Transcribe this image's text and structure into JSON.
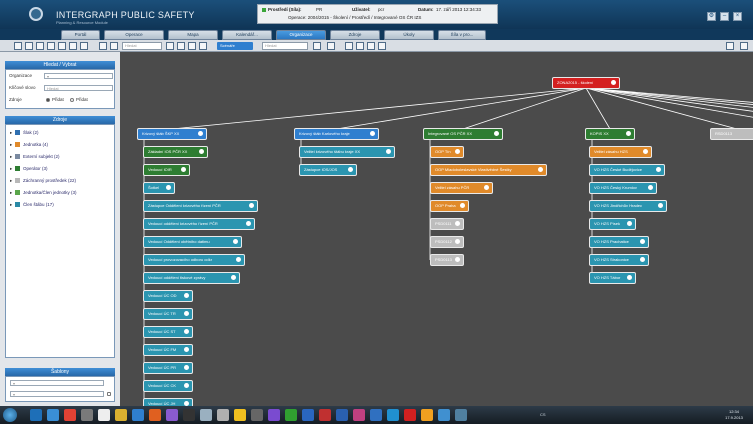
{
  "header": {
    "title": "INTERGRAPH PUBLIC SAFETY",
    "subtitle": "Planning & Resource Module",
    "info": {
      "line1_label": "Prostředí (Síla):",
      "line1_value": "PR",
      "user_label": "Uživatel:",
      "user_value": "pcr",
      "date_label": "Datum:",
      "date_value": "17. září 2013 12:34:33",
      "line2": "Operace:  2004/2015 - Školení  /  Prostředí  /  Integrované OS ČR IZS"
    },
    "buttons": [
      "settings",
      "minimize",
      "close"
    ]
  },
  "module_tabs": [
    {
      "label": "Portál",
      "active": false
    },
    {
      "label": "Operace",
      "active": false
    },
    {
      "label": "Mapa",
      "active": false
    },
    {
      "label": "Kalendář...",
      "active": false
    },
    {
      "label": "Organizace",
      "active": true
    },
    {
      "label": "Zdroje",
      "active": false
    },
    {
      "label": "Úkoly",
      "active": false
    },
    {
      "label": "Šíla v pro...",
      "active": false
    }
  ],
  "toolbar": {
    "search_placeholder": "Hledat",
    "search2_placeholder": "Hledat",
    "scenario_label": "Scénáře"
  },
  "left_panel": {
    "filter_header": "Hledat / Vybrat",
    "filter": {
      "organization_label": "Organizace",
      "keyword_label": "Klíčové slovo",
      "keyword_placeholder": "Hledat",
      "source_label": "Zdroje",
      "radio_show": "Přidat",
      "radio_move": "Přidat"
    },
    "resources_header": "Zdroje",
    "resources": [
      {
        "label": "Šlak (2)",
        "color": "#2f6fb0"
      },
      {
        "label": "Jednotka (4)",
        "color": "#e08a2a"
      },
      {
        "label": "Externí subjekt (2)",
        "color": "#7a8aa0"
      },
      {
        "label": "Operátor (3)",
        "color": "#2e7d32"
      },
      {
        "label": "Záchranný prostředek (22)",
        "color": "#b8b8b8"
      },
      {
        "label": "Jednotka/Člen jednotky (3)",
        "color": "#5aa64a"
      },
      {
        "label": "Člen štábu (17)",
        "color": "#2b8aa6"
      }
    ],
    "templates_header": "Šablony"
  },
  "chart": {
    "root": "ZONA2015 - školení",
    "columns": [
      {
        "header": "Krizový štáb ŠKP XX",
        "header_color": "#2f7fcf",
        "children": [
          {
            "label": "Základní IOS PČR XX",
            "color": "#2e7d32"
          },
          {
            "label": "Vedoucí IOIR",
            "color": "#2e7d32"
          },
          {
            "label": "Šotkel",
            "color": "#2b95b0"
          },
          {
            "label": "Zástupce Oddělení krizového řízení PČR",
            "color": "#2b95b0"
          },
          {
            "label": "Vedoucí oddělení krizového řízení PČR",
            "color": "#2b95b0"
          },
          {
            "label": "Vedoucí Oddělení obětního datimu",
            "color": "#2b95b0"
          },
          {
            "label": "Vedoucí provozovacího odboru odkr",
            "color": "#2b95b0"
          },
          {
            "label": "Vedoucí oddělení tiskové zprávy",
            "color": "#2b95b0"
          },
          {
            "label": "Vedoucí ÚC OD",
            "color": "#2b95b0"
          },
          {
            "label": "Vedoucí ÚC TR",
            "color": "#2b95b0"
          },
          {
            "label": "Vedoucí ÚC ST",
            "color": "#2b95b0"
          },
          {
            "label": "Vedoucí ÚC FM",
            "color": "#2b95b0"
          },
          {
            "label": "Vedoucí ÚC PR",
            "color": "#2b95b0"
          },
          {
            "label": "Vedoucí ÚC CK",
            "color": "#2b95b0"
          },
          {
            "label": "Vedoucí ÚC JH",
            "color": "#2b95b0"
          }
        ]
      },
      {
        "header": "Krizový štáb Karlového kraje",
        "header_color": "#2f7fcf",
        "children": [
          {
            "label": "Velitel krizového štábu kraje XX",
            "color": "#2b95b0"
          },
          {
            "label": "Zástupce IOS/JOS",
            "color": "#2b95b0"
          }
        ]
      },
      {
        "header": "Integrované OS PČR XX",
        "header_color": "#2e7d32",
        "children": [
          {
            "label": "OOP Tín",
            "color": "#e08a2a"
          },
          {
            "label": "OOP Mladoboleslavské Vlastivědné Šestky",
            "color": "#e08a2a"
          },
          {
            "label": "Velitel zásahu PČR",
            "color": "#e08a2a"
          },
          {
            "label": "OOP Praha",
            "color": "#e08a2a"
          },
          {
            "label": "PSD0111",
            "color": "#bdbdbd"
          },
          {
            "label": "PSD0112",
            "color": "#bdbdbd"
          },
          {
            "label": "PSD0113",
            "color": "#bdbdbd"
          }
        ]
      },
      {
        "header": "KOPIS XX",
        "header_color": "#2e7d32",
        "children": [
          {
            "label": "Velitel zásahu HZS",
            "color": "#e08a2a"
          },
          {
            "label": "VO HZS České Budějovice",
            "color": "#2b95b0"
          },
          {
            "label": "VO HZS Český Krumlov",
            "color": "#2b95b0"
          },
          {
            "label": "VO HZS Jindřichův Hradec",
            "color": "#2b95b0"
          },
          {
            "label": "VO HZS Písek",
            "color": "#2b95b0"
          },
          {
            "label": "VO HZS Prachatice",
            "color": "#2b95b0"
          },
          {
            "label": "VO HZS Strakonice",
            "color": "#2b95b0"
          },
          {
            "label": "VO HZS Tábor",
            "color": "#2b95b0"
          }
        ]
      },
      {
        "header": "RSD0113",
        "header_color": "#bdbdbd",
        "children": []
      }
    ]
  },
  "taskbar": {
    "apps": [
      "#1e6fb8",
      "#3a8fd6",
      "#e34234",
      "#7a7a7a",
      "#eeeeee",
      "#d9b030",
      "#2f7fcf",
      "#e06020",
      "#8a5bd0",
      "#333333",
      "#9ab0c0",
      "#b0b0b0",
      "#f0c020",
      "#666666",
      "#7a4bd0",
      "#30a030",
      "#2a66c0",
      "#c03030",
      "#2a60b0",
      "#c04080",
      "#3070c0",
      "#2090d0",
      "#d02020",
      "#f0a020",
      "#4090d0",
      "#5080a0"
    ],
    "tray": "CS",
    "time": "12:34",
    "date": "17.9.2013"
  }
}
